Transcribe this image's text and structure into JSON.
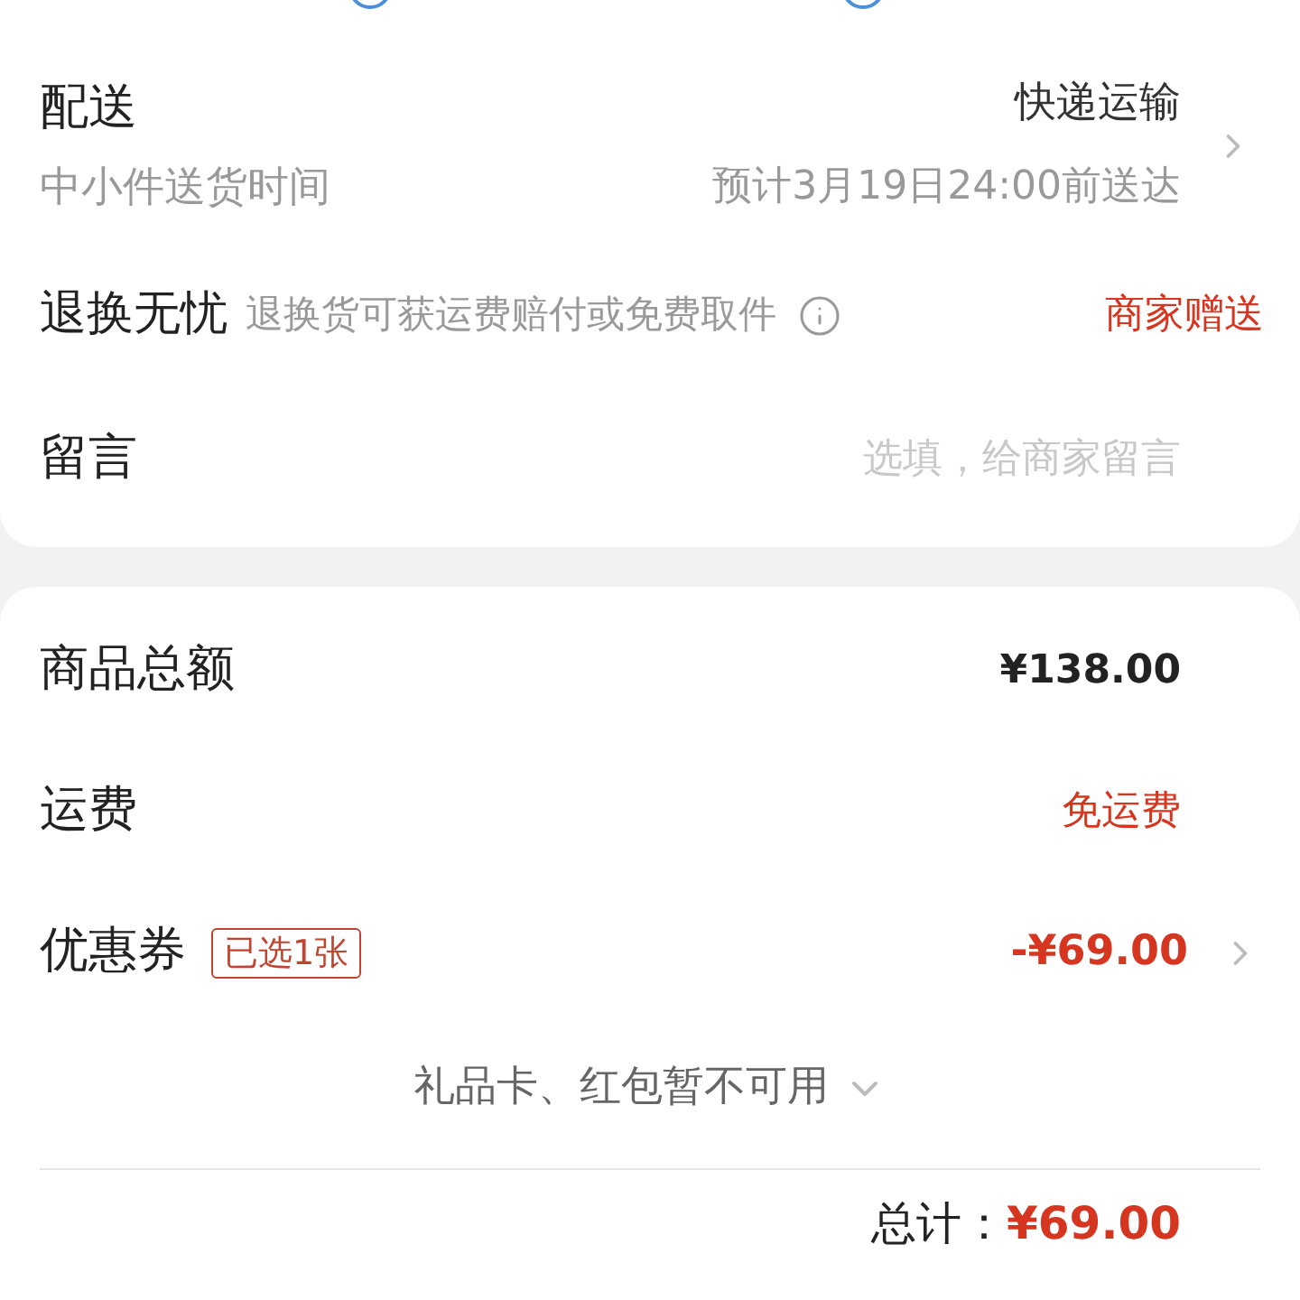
{
  "delivery": {
    "label": "配送",
    "method": "快递运输",
    "sublabel": "中小件送货时间",
    "estimate": "预计3月19日24:00前送达"
  },
  "returns": {
    "label": "退换无忧",
    "description": "退换货可获运费赔付或免费取件",
    "value": "商家赠送"
  },
  "message": {
    "label": "留言",
    "placeholder": "选填，给商家留言"
  },
  "summary": [
    {
      "kind": "plain",
      "label": "商品总额",
      "value": "¥138.00"
    },
    {
      "kind": "highlight",
      "label": "运费",
      "value": "免运费"
    },
    {
      "kind": "coupon",
      "label": "优惠券",
      "badge": "已选1张",
      "value": "-¥69.00"
    }
  ],
  "gift_notice": "礼品卡、红包暂不可用",
  "total": {
    "label": "总计：",
    "value": "¥69.00"
  }
}
